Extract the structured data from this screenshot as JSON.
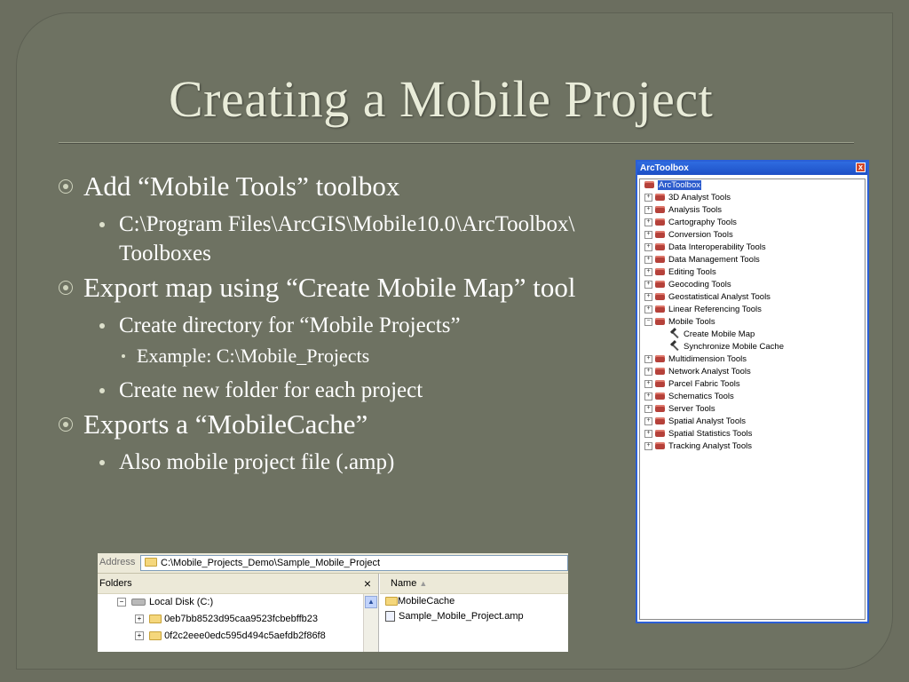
{
  "slide": {
    "title": "Creating a Mobile Project",
    "bullets": [
      {
        "text": "Add “Mobile Tools” toolbox",
        "sub": [
          {
            "text": "C:\\Program Files\\ArcGIS\\Mobile10.0\\ArcToolbox\\ Toolboxes"
          }
        ]
      },
      {
        "text": "Export map using “Create Mobile Map” tool",
        "sub": [
          {
            "text": "Create directory for “Mobile Projects”",
            "sub": [
              "Example: C:\\Mobile_Projects"
            ]
          },
          {
            "text": "Create new folder for each project"
          }
        ]
      },
      {
        "text": "Exports a “MobileCache”",
        "sub": [
          {
            "text": "Also mobile project file (.amp)"
          }
        ]
      }
    ]
  },
  "arctoolbox": {
    "title": "ArcToolbox",
    "close": "x",
    "root": "ArcToolbox",
    "items": [
      "3D Analyst Tools",
      "Analysis Tools",
      "Cartography Tools",
      "Conversion Tools",
      "Data Interoperability Tools",
      "Data Management Tools",
      "Editing Tools",
      "Geocoding Tools",
      "Geostatistical Analyst Tools",
      "Linear Referencing Tools",
      "Mobile Tools",
      "Create Mobile Map",
      "Synchronize Mobile Cache",
      "Multidimension Tools",
      "Network Analyst Tools",
      "Parcel Fabric Tools",
      "Schematics Tools",
      "Server Tools",
      "Spatial Analyst Tools",
      "Spatial Statistics Tools",
      "Tracking Analyst Tools"
    ]
  },
  "explorer": {
    "address_label": "Address",
    "address": "C:\\Mobile_Projects_Demo\\Sample_Mobile_Project",
    "folders_label": "Folders",
    "close": "×",
    "tree": [
      "Local Disk (C:)",
      "0eb7bb8523d95caa9523fcbebffb23",
      "0f2c2eee0edc595d494c5aefdb2f86f8"
    ],
    "name_header": "Name",
    "files": [
      "MobileCache",
      "Sample_Mobile_Project.amp"
    ]
  }
}
